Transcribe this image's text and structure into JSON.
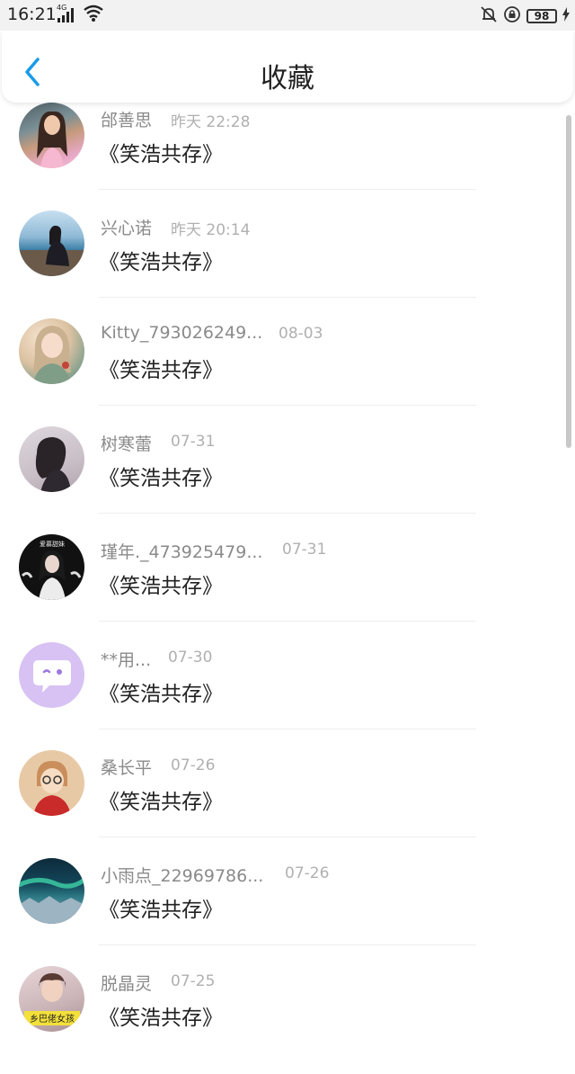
{
  "status_bar": {
    "time": "16:21",
    "network": "4G",
    "battery": "98"
  },
  "header": {
    "title": "收藏"
  },
  "items": [
    {
      "name": "邰善思",
      "time": "昨天 22:28",
      "title": "《笑浩共存》"
    },
    {
      "name": "兴心诺",
      "time": "昨天 20:14",
      "title": "《笑浩共存》"
    },
    {
      "name": "Kitty_793026249...",
      "time": "08-03",
      "title": "《笑浩共存》"
    },
    {
      "name": "树寒蕾",
      "time": "07-31",
      "title": "《笑浩共存》"
    },
    {
      "name": "瑾年._473925479...",
      "time": "07-31",
      "title": "《笑浩共存》"
    },
    {
      "name": "**用...",
      "time": "07-30",
      "title": "《笑浩共存》"
    },
    {
      "name": "桑长平",
      "time": "07-26",
      "title": "《笑浩共存》"
    },
    {
      "name": "小雨点_22969786...",
      "time": "07-26",
      "title": "《笑浩共存》"
    },
    {
      "name": "脱晶灵",
      "time": "07-25",
      "title": "《笑浩共存》"
    }
  ],
  "avatar_badges": {
    "item_4": "爱慕甜妹",
    "item_8": "乡巴佬女孩"
  },
  "colors": {
    "accent": "#1a9be8",
    "name": "#8a8a8a",
    "time": "#b0b0b0",
    "title": "#222222"
  }
}
